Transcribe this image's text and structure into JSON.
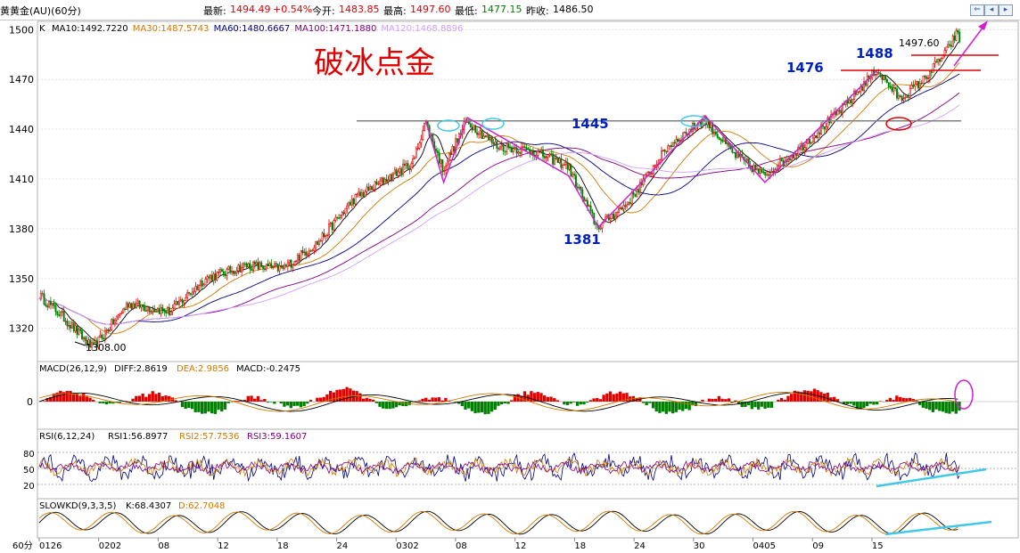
{
  "header": {
    "symbol": "黄黄金(AU)(60分)",
    "last_label": "最新:",
    "last_value": "1494.49",
    "change": "+0.54%",
    "open_label": "今开:",
    "open_value": "1483.85",
    "high_label": "最高:",
    "high_value": "1497.60",
    "low_label": "最低:",
    "low_value": "1477.15",
    "prev_label": "昨收:",
    "prev_value": "1486.50",
    "btn_prev": "⇐",
    "btn_left": "◂",
    "btn_right": "▸",
    "btn_next": "⇒"
  },
  "main_panel": {
    "indicator": "K",
    "ma": [
      {
        "label": "MA10:1492.7220",
        "color": "#000000"
      },
      {
        "label": "MA30:1487.5743",
        "color": "#d07800"
      },
      {
        "label": "MA60:1480.6667",
        "color": "#000080"
      },
      {
        "label": "MA100:1471.1880",
        "color": "#800080"
      },
      {
        "label": "MA120:1468.8896",
        "color": "#d0a0ff"
      }
    ],
    "title": "破冰点金",
    "annotations": {
      "n1445": "1445",
      "n1381": "1381",
      "n1476": "1476",
      "n1488": "1488",
      "n1497": "1497.60",
      "n1308": "1308.00"
    }
  },
  "macd_panel": {
    "label": "MACD(26,12,9)",
    "diff": "DIFF:2.8619",
    "dea": "DEA:2.9856",
    "macd": "MACD:-0.2475",
    "zero": "0"
  },
  "rsi_panel": {
    "label": "RSI(6,12,24)",
    "rsi1": "RSI1:56.8977",
    "rsi2": "RSI2:57.7536",
    "rsi3": "RSI3:59.1607",
    "ticks": [
      "80",
      "50",
      "20"
    ]
  },
  "kd_panel": {
    "label": "SLOWKD(9,3,3,5)",
    "k": "K:68.4307",
    "d": "D:62.7048"
  },
  "xaxis": {
    "period": "60分",
    "labels": [
      "0126",
      "0202",
      "08",
      "12",
      "18",
      "24",
      "0302",
      "08",
      "12",
      "18",
      "24",
      "30",
      "0405",
      "09",
      "15"
    ]
  },
  "colors": {
    "up": "#e00000",
    "down": "#008000",
    "annotation_blue": "#0020c0",
    "title_red": "#e00000",
    "magenta": "#d020d0",
    "cyan": "#40c8e8",
    "level_line": "#808080"
  },
  "chart_data": [
    {
      "type": "candlestick",
      "panel": "price",
      "x_tick_labels": [
        "0126",
        "0202",
        "08",
        "12",
        "18",
        "24",
        "0302",
        "08",
        "12",
        "18",
        "24",
        "30",
        "0405",
        "09",
        "15"
      ],
      "ylim": [
        1300,
        1505
      ],
      "y_ticks": [
        1320,
        1350,
        1380,
        1410,
        1440,
        1470,
        1500
      ],
      "grid": true,
      "pivot_points": [
        {
          "x": 0.0,
          "y": 1340
        },
        {
          "x": 0.4,
          "y": 1327
        },
        {
          "x": 0.9,
          "y": 1308
        },
        {
          "x": 1.5,
          "y": 1335
        },
        {
          "x": 2.2,
          "y": 1330
        },
        {
          "x": 2.8,
          "y": 1350
        },
        {
          "x": 3.5,
          "y": 1358
        },
        {
          "x": 4.1,
          "y": 1356
        },
        {
          "x": 4.7,
          "y": 1372
        },
        {
          "x": 5.3,
          "y": 1398
        },
        {
          "x": 5.8,
          "y": 1409
        },
        {
          "x": 6.3,
          "y": 1420
        },
        {
          "x": 6.5,
          "y": 1445
        },
        {
          "x": 6.8,
          "y": 1416
        },
        {
          "x": 7.2,
          "y": 1445
        },
        {
          "x": 7.7,
          "y": 1430
        },
        {
          "x": 8.3,
          "y": 1427
        },
        {
          "x": 8.9,
          "y": 1418
        },
        {
          "x": 9.4,
          "y": 1381
        },
        {
          "x": 9.9,
          "y": 1395
        },
        {
          "x": 10.6,
          "y": 1430
        },
        {
          "x": 11.2,
          "y": 1446
        },
        {
          "x": 11.7,
          "y": 1425
        },
        {
          "x": 12.2,
          "y": 1412
        },
        {
          "x": 12.7,
          "y": 1425
        },
        {
          "x": 13.1,
          "y": 1438
        },
        {
          "x": 13.6,
          "y": 1455
        },
        {
          "x": 14.1,
          "y": 1476
        },
        {
          "x": 14.5,
          "y": 1458
        },
        {
          "x": 14.9,
          "y": 1470
        },
        {
          "x": 15.3,
          "y": 1488
        },
        {
          "x": 15.45,
          "y": 1497.6
        },
        {
          "x": 15.5,
          "y": 1494.49
        }
      ],
      "resistance_level": 1445,
      "labels": [
        "1445",
        "1381",
        "1476",
        "1488",
        "1497.60",
        "1308.00"
      ]
    },
    {
      "type": "bar",
      "panel": "MACD",
      "zero_line": 0,
      "values": [
        -1,
        2,
        5,
        -3,
        1,
        -2,
        3,
        1,
        -2,
        2,
        -1,
        1,
        3,
        2,
        -2,
        -3,
        1,
        2,
        -1,
        2,
        -2,
        -1,
        1,
        2,
        -1,
        1,
        -2,
        2,
        1,
        -0.2475
      ]
    },
    {
      "type": "line",
      "panel": "RSI",
      "ylim": [
        0,
        100
      ],
      "series": [
        {
          "name": "RSI1",
          "values": [
            50,
            62,
            38,
            70,
            45,
            58,
            35,
            66,
            52,
            40,
            72,
            48,
            55,
            30,
            63,
            57,
            44,
            68,
            51,
            56.8977
          ]
        }
      ]
    },
    {
      "type": "line",
      "panel": "SLOWKD",
      "ylim": [
        0,
        100
      ],
      "series": [
        {
          "name": "K",
          "values": [
            40,
            70,
            30,
            65,
            35,
            75,
            45,
            60,
            30,
            70,
            40,
            65,
            55,
            68.4307
          ]
        },
        {
          "name": "D",
          "values": [
            45,
            60,
            38,
            58,
            42,
            65,
            48,
            55,
            38,
            60,
            45,
            60,
            55,
            62.7048
          ]
        }
      ]
    }
  ]
}
